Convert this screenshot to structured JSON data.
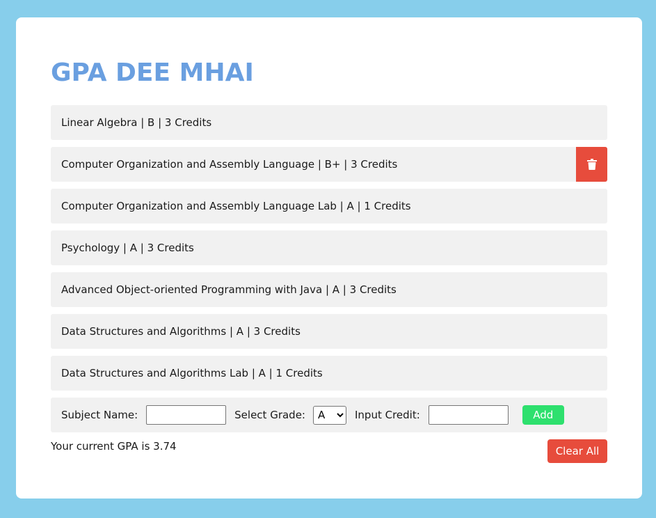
{
  "app": {
    "title": "GPA DEE MHAI"
  },
  "courses": [
    {
      "label": "Linear Algebra | B | 3 Credits"
    },
    {
      "label": "Computer Organization and Assembly Language | B+ | 3 Credits",
      "hovered": true
    },
    {
      "label": "Computer Organization and Assembly Language Lab | A | 1 Credits"
    },
    {
      "label": "Psychology | A | 3 Credits"
    },
    {
      "label": "Advanced Object-oriented Programming with Java | A | 3 Credits"
    },
    {
      "label": "Data Structures and Algorithms | A | 3 Credits"
    },
    {
      "label": "Data Structures and Algorithms Lab | A | 1 Credits"
    }
  ],
  "form": {
    "subject_label": "Subject Name:",
    "subject_value": "",
    "grade_label": "Select Grade:",
    "grade_selected": "A",
    "credit_label": "Input Credit:",
    "credit_value": "",
    "add_label": "Add"
  },
  "summary": {
    "gpa_text": "Your current GPA is 3.74",
    "clear_label": "Clear All"
  },
  "icons": {
    "delete": "trash-icon"
  },
  "colors": {
    "background": "#87ceeb",
    "title": "#6a9fe0",
    "danger": "#e74c3c",
    "success": "#2ee06e",
    "row": "#f1f1f1"
  }
}
